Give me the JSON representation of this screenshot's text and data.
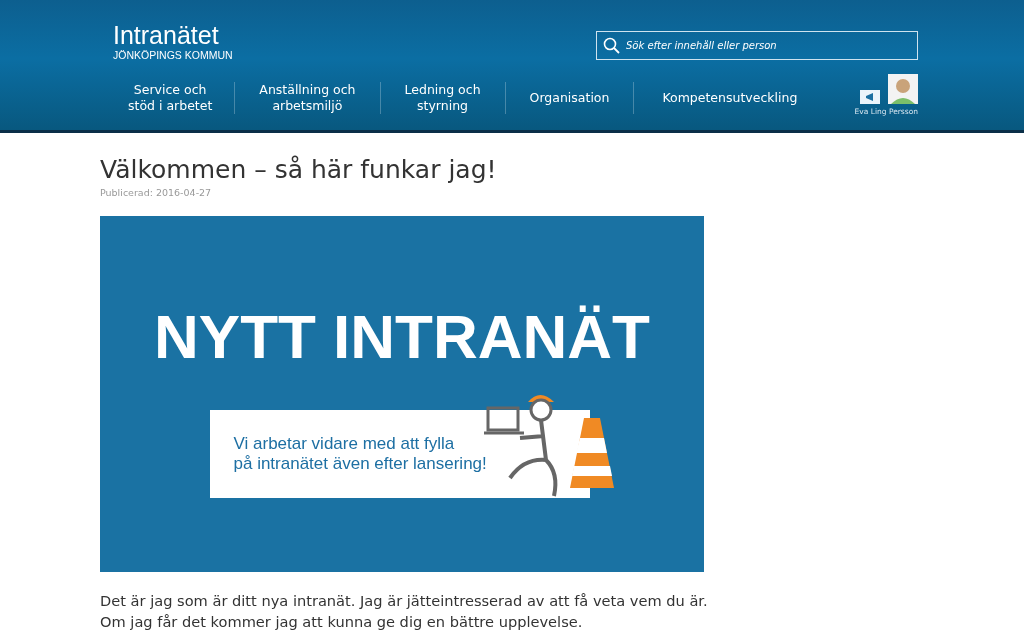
{
  "logo": {
    "title": "Intranätet",
    "subtitle": "JÖNKÖPINGS KOMMUN"
  },
  "search": {
    "placeholder": "Sök efter innehåll eller person"
  },
  "nav": [
    {
      "label": "Service och\nstöd i arbetet"
    },
    {
      "label": "Anställning och\narbetsmiljö"
    },
    {
      "label": "Ledning och\nstyrning"
    },
    {
      "label": "Organisation"
    },
    {
      "label": "Kompetensutveckling"
    }
  ],
  "user": {
    "name": "Eva Ling Persson"
  },
  "article": {
    "title": "Välkommen – så här funkar jag!",
    "published": "Publicerad: 2016-04-27",
    "banner": {
      "headline": "NYTT INTRANÄT",
      "message": "Vi arbetar vidare med att fylla\npå intranätet även efter lansering!"
    },
    "body": "Det är jag som är ditt nya intranät. Jag är jätteintresserad av att få veta vem du är. Om jag får det kommer jag att kunna ge dig en bättre upplevelse."
  }
}
